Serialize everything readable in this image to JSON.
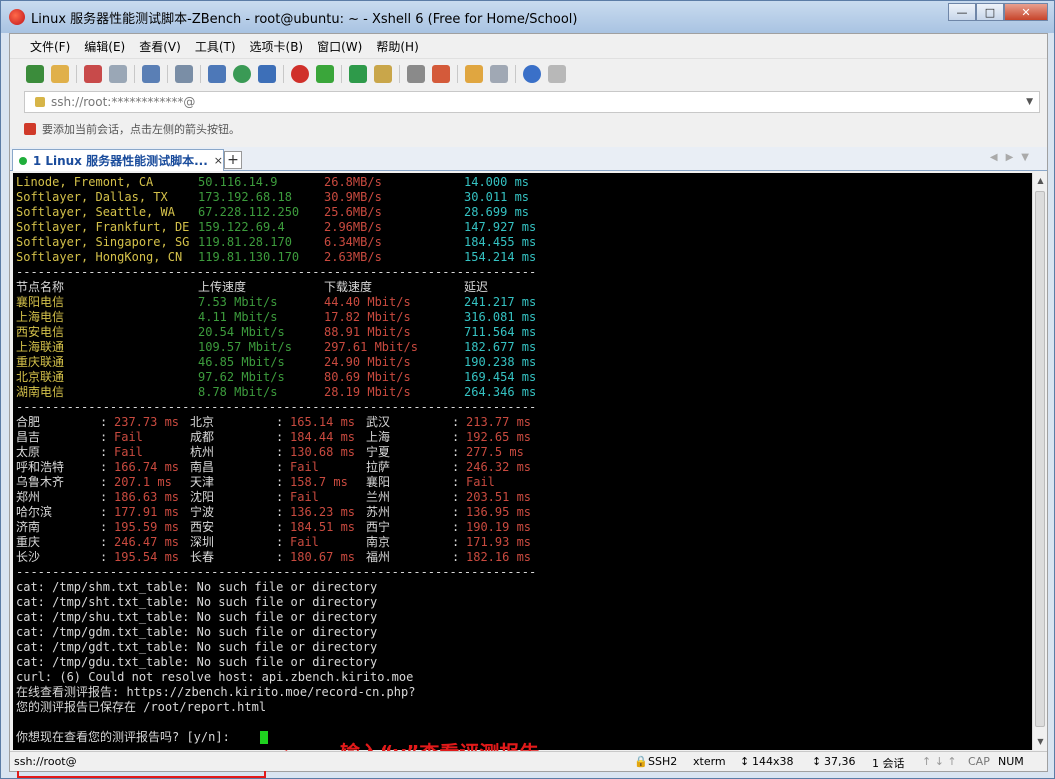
{
  "window": {
    "title": "Linux 服务器性能测试脚本-ZBench - root@ubuntu: ~ - Xshell 6 (Free for Home/School)"
  },
  "menu": [
    "文件(F)",
    "编辑(E)",
    "查看(V)",
    "工具(T)",
    "选项卡(B)",
    "窗口(W)",
    "帮助(H)"
  ],
  "address": "ssh://root:************@",
  "hint": "要添加当前会话，点击左侧的箭头按钮。",
  "tab": {
    "label": "1 Linux 服务器性能测试脚本...",
    "close": "×",
    "add": "+"
  },
  "intl_rows": [
    [
      "Linode, Fremont, CA",
      "50.116.14.9",
      "26.8MB/s",
      "14.000 ms"
    ],
    [
      "Softlayer, Dallas, TX",
      "173.192.68.18",
      "30.9MB/s",
      "30.011 ms"
    ],
    [
      "Softlayer, Seattle, WA",
      "67.228.112.250",
      "25.6MB/s",
      "28.699 ms"
    ],
    [
      "Softlayer, Frankfurt, DE",
      "159.122.69.4",
      "2.96MB/s",
      "147.927 ms"
    ],
    [
      "Softlayer, Singapore, SG",
      "119.81.28.170",
      "6.34MB/s",
      "184.455 ms"
    ],
    [
      "Softlayer, HongKong, CN",
      "119.81.130.170",
      "2.63MB/s",
      "154.214 ms"
    ]
  ],
  "divider": "------------------------------------------------------------------------",
  "speed_header": [
    "节点名称",
    "上传速度",
    "下载速度",
    "延迟"
  ],
  "speed_rows": [
    [
      "襄阳电信",
      "7.53 Mbit/s",
      "44.40 Mbit/s",
      "241.217 ms"
    ],
    [
      "上海电信",
      "4.11 Mbit/s",
      "17.82 Mbit/s",
      "316.081 ms"
    ],
    [
      "西安电信",
      "20.54 Mbit/s",
      "88.91 Mbit/s",
      "711.564 ms"
    ],
    [
      "上海联通",
      "109.57 Mbit/s",
      "297.61 Mbit/s",
      "182.677 ms"
    ],
    [
      "重庆联通",
      "46.85 Mbit/s",
      "24.90 Mbit/s",
      "190.238 ms"
    ],
    [
      "北京联通",
      "97.62 Mbit/s",
      "80.69 Mbit/s",
      "169.454 ms"
    ],
    [
      "湖南电信",
      "8.78 Mbit/s",
      "28.19 Mbit/s",
      "264.346 ms"
    ]
  ],
  "ping_rows": [
    [
      [
        "合肥",
        "237.73 ms"
      ],
      [
        "北京",
        "165.14 ms"
      ],
      [
        "武汉",
        "213.77 ms"
      ]
    ],
    [
      [
        "昌吉",
        "Fail"
      ],
      [
        "成都",
        "184.44 ms"
      ],
      [
        "上海",
        "192.65 ms"
      ]
    ],
    [
      [
        "太原",
        "Fail"
      ],
      [
        "杭州",
        "130.68 ms"
      ],
      [
        "宁夏",
        "277.5 ms"
      ]
    ],
    [
      [
        "呼和浩特",
        "166.74 ms"
      ],
      [
        "南昌",
        "Fail"
      ],
      [
        "拉萨",
        "246.32 ms"
      ]
    ],
    [
      [
        "乌鲁木齐",
        "207.1 ms"
      ],
      [
        "天津",
        "158.7 ms"
      ],
      [
        "襄阳",
        "Fail"
      ]
    ],
    [
      [
        "郑州",
        "186.63 ms"
      ],
      [
        "沈阳",
        "Fail"
      ],
      [
        "兰州",
        "203.51 ms"
      ]
    ],
    [
      [
        "哈尔滨",
        "177.91 ms"
      ],
      [
        "宁波",
        "136.23 ms"
      ],
      [
        "苏州",
        "136.95 ms"
      ]
    ],
    [
      [
        "济南",
        "195.59 ms"
      ],
      [
        "西安",
        "184.51 ms"
      ],
      [
        "西宁",
        "190.19 ms"
      ]
    ],
    [
      [
        "重庆",
        "246.47 ms"
      ],
      [
        "深圳",
        "Fail"
      ],
      [
        "南京",
        "171.93 ms"
      ]
    ],
    [
      [
        "长沙",
        "195.54 ms"
      ],
      [
        "长春",
        "180.67 ms"
      ],
      [
        "福州",
        "182.16 ms"
      ]
    ]
  ],
  "output_lines": [
    "cat: /tmp/shm.txt_table: No such file or directory",
    "cat: /tmp/sht.txt_table: No such file or directory",
    "cat: /tmp/shu.txt_table: No such file or directory",
    "cat: /tmp/gdm.txt_table: No such file or directory",
    "cat: /tmp/gdt.txt_table: No such file or directory",
    "cat: /tmp/gdu.txt_table: No such file or directory",
    "curl: (6) Could not resolve host: api.zbench.kirito.moe",
    "在线查看测评报告: https://zbench.kirito.moe/record-cn.php?",
    "您的测评报告已保存在 /root/report.html"
  ],
  "prompt": "你想现在查看您的测评报告吗? [y/n]:",
  "annotation": "输入“y”查看评测报告",
  "status": {
    "conn": "ssh://root@",
    "proto": "SSH2",
    "term": "xterm",
    "size": "144x38",
    "pos": "37,36",
    "sessions": "1 会话",
    "cap": "CAP",
    "num": "NUM"
  },
  "colors": {
    "yellow": "#d4c14a",
    "green": "#3d9c3d",
    "red": "#c94a3f",
    "cyan": "#35c2c2",
    "annotation": "#e21a1a"
  }
}
